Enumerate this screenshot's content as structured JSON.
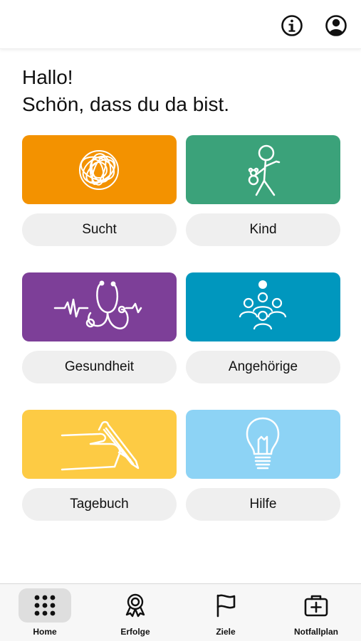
{
  "header": {
    "info_icon": "info-icon",
    "profile_icon": "profile-icon"
  },
  "greeting": {
    "line1": "Hallo!",
    "line2": "Schön, dass du da bist."
  },
  "categories": [
    {
      "label": "Sucht",
      "color": "#F39200",
      "icon": "tangle-icon"
    },
    {
      "label": "Kind",
      "color": "#3BA27A",
      "icon": "child-with-teddy-icon"
    },
    {
      "label": "Gesundheit",
      "color": "#7D3F98",
      "icon": "stethoscope-icon"
    },
    {
      "label": "Angehörige",
      "color": "#0097BE",
      "icon": "group-icon"
    },
    {
      "label": "Tagebuch",
      "color": "#FDCB44",
      "icon": "writing-hand-icon"
    },
    {
      "label": "Hilfe",
      "color": "#8DD3F5",
      "icon": "lightbulb-icon"
    }
  ],
  "nav": {
    "active": "Home",
    "items": [
      {
        "label": "Home",
        "icon": "grid-icon"
      },
      {
        "label": "Erfolge",
        "icon": "award-icon"
      },
      {
        "label": "Ziele",
        "icon": "flag-icon"
      },
      {
        "label": "Notfallplan",
        "icon": "first-aid-kit-icon"
      }
    ]
  }
}
